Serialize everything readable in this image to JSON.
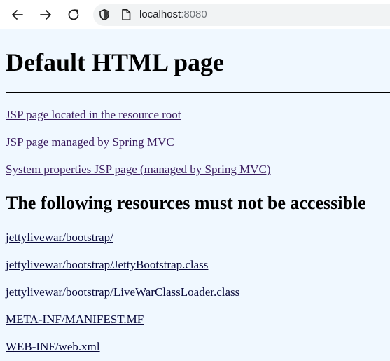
{
  "browser": {
    "url_host": "localhost",
    "url_port": ":8080",
    "icons": {
      "back": "back-arrow-icon",
      "forward": "forward-arrow-icon",
      "reload": "reload-icon",
      "security": "shield-icon",
      "page": "page-info-icon"
    }
  },
  "page": {
    "title": "Default HTML page",
    "links": [
      {
        "label": "JSP page located in the resource root"
      },
      {
        "label": "JSP page managed by Spring MVC"
      },
      {
        "label": "System properties JSP page (managed by Spring MVC)"
      }
    ],
    "restricted_heading": "The following resources must not be accessible",
    "restricted_links": [
      {
        "label": "jettylivewar/bootstrap/"
      },
      {
        "label": "jettylivewar/bootstrap/JettyBootstrap.class"
      },
      {
        "label": "jettylivewar/bootstrap/LiveWarClassLoader.class"
      },
      {
        "label": "META-INF/MANIFEST.MF"
      },
      {
        "label": "WEB-INF/web.xml"
      }
    ],
    "colors": {
      "background": "#f0f8ff",
      "link_visited": "#3a1b5e",
      "link": "#0a0a3c"
    }
  }
}
